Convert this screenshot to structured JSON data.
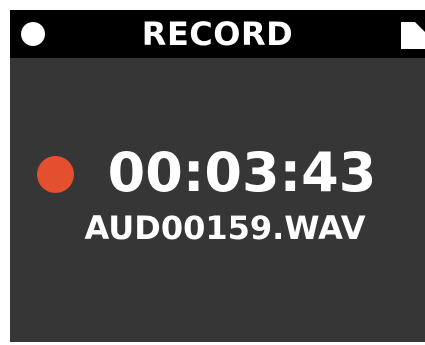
{
  "header": {
    "title": "RECORD",
    "left_indicator": "status-dot-icon",
    "right_icon": "file-icon"
  },
  "recording": {
    "timer": "00:03:43",
    "filename": "AUD00159.WAV",
    "indicator_icon": "record-dot-icon"
  },
  "colors": {
    "header_bg": "#000000",
    "screen_bg": "#363636",
    "text": "#ffffff",
    "record_red": "#E4502F"
  }
}
